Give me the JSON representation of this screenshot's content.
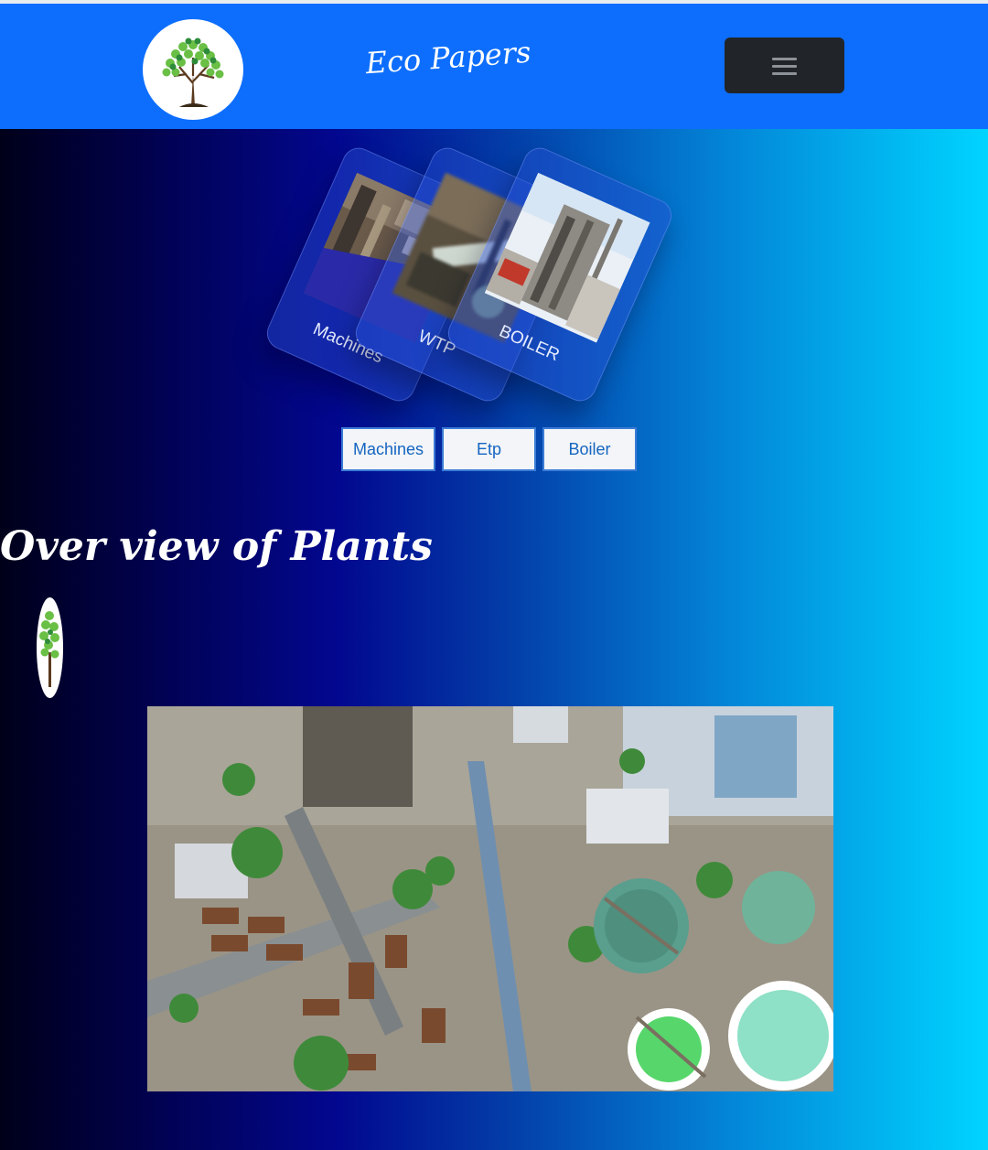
{
  "header": {
    "brand": "Eco Papers",
    "logo_icon": "tree-icon",
    "menu_icon": "hamburger-menu-icon"
  },
  "gallery": {
    "cards": [
      {
        "label": "Machines"
      },
      {
        "label": "WTP"
      },
      {
        "label": "BOILER"
      }
    ],
    "buttons": [
      "Machines",
      "Etp",
      "Boiler"
    ]
  },
  "overview": {
    "title": "Over view of Plants"
  },
  "colors": {
    "navbar": "#0d6efd",
    "toggler": "#212529",
    "gradient_start": "#00001a",
    "gradient_end": "#00d4ff",
    "button_text": "#1565c0"
  }
}
